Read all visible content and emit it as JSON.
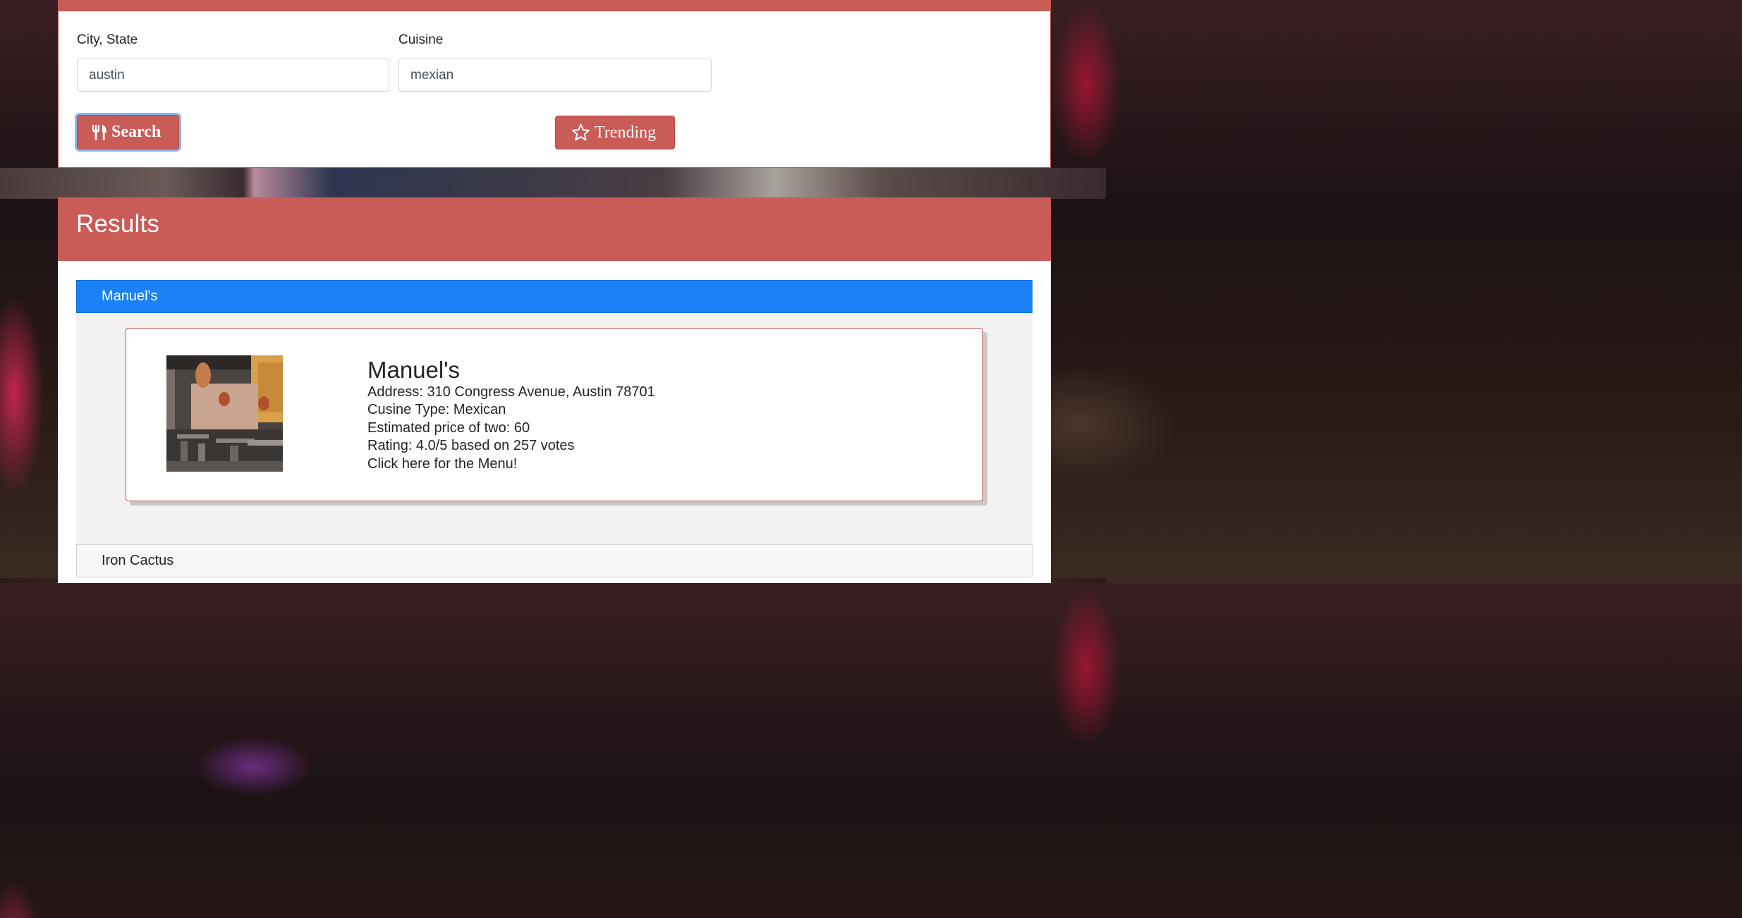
{
  "search": {
    "city_label": "City, State",
    "city_value": "austin",
    "cuisine_label": "Cuisine",
    "cuisine_value": "mexian",
    "search_button": "Search",
    "trending_button": "Trending"
  },
  "results": {
    "title": "Results",
    "items": [
      {
        "header": "Manuel's",
        "expanded": true,
        "name": "Manuel's",
        "address": "Address: 310 Congress Avenue, Austin 78701",
        "cuisine": "Cusine Type: Mexican",
        "price": "Estimated price of two: 60",
        "rating": "Rating: 4.0/5 based on 257 votes",
        "menu_link": "Click here for the Menu!"
      },
      {
        "header": "Iron Cactus",
        "expanded": false
      }
    ]
  },
  "colors": {
    "accent": "#c95c56",
    "active_accordion": "#1b82f5"
  },
  "icons": {
    "search": "utensils-icon",
    "trending": "star-icon"
  }
}
